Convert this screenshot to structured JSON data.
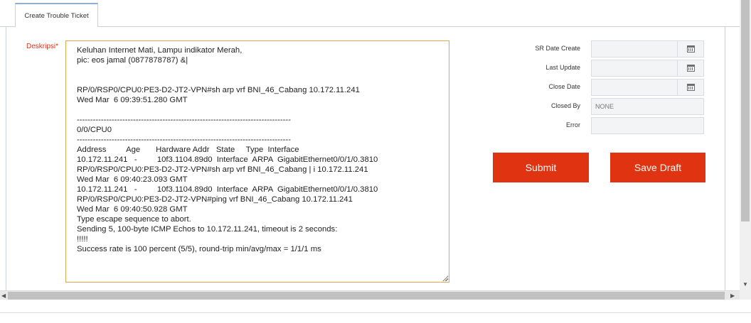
{
  "tab": {
    "label": "Create Trouble Ticket"
  },
  "description": {
    "label": "Deskripsi",
    "required_mark": "*",
    "value": "Keluhan Internet Mati, Lampu indikator Merah,\npic: eos jamal (0877878787) &|\n\n\nRP/0/RSP0/CPU0:PE3-D2-JT2-VPN#sh arp vrf BNI_46_Cabang 10.172.11.241\nWed Mar  6 09:39:51.280 GMT\n\n--------------------------------------------------------------------------------\n0/0/CPU0\n--------------------------------------------------------------------------------\nAddress         Age       Hardware Addr   State     Type  Interface\n10.172.11.241   -         10f3.1104.89d0  Interface  ARPA  GigabitEthernet0/0/1/0.3810\nRP/0/RSP0/CPU0:PE3-D2-JT2-VPN#sh arp vrf BNI_46_Cabang | i 10.172.11.241\nWed Mar  6 09:40:23.093 GMT\n10.172.11.241   -         10f3.1104.89d0  Interface  ARPA  GigabitEthernet0/0/1/0.3810\nRP/0/RSP0/CPU0:PE3-D2-JT2-VPN#ping vrf BNI_46_Cabang 10.172.11.241\nWed Mar  6 09:40:50.928 GMT\nType escape sequence to abort.\nSending 5, 100-byte ICMP Echos to 10.172.11.241, timeout is 2 seconds:\n!!!!!\nSuccess rate is 100 percent (5/5), round-trip min/avg/max = 1/1/1 ms"
  },
  "form": {
    "sr_date_create": {
      "label": "SR Date Create",
      "value": "",
      "icon": "calendar-icon"
    },
    "last_update": {
      "label": "Last Update",
      "value": "",
      "icon": "calendar-icon"
    },
    "close_date": {
      "label": "Close Date",
      "value": "",
      "icon": "calendar-icon"
    },
    "closed_by": {
      "label": "Closed By",
      "value": "NONE"
    },
    "error": {
      "label": "Error",
      "value": ""
    }
  },
  "buttons": {
    "submit": "Submit",
    "save_draft": "Save Draft"
  },
  "colors": {
    "accent": "#e03311",
    "required": "#e0321b",
    "focus_border": "#e0a44a"
  }
}
